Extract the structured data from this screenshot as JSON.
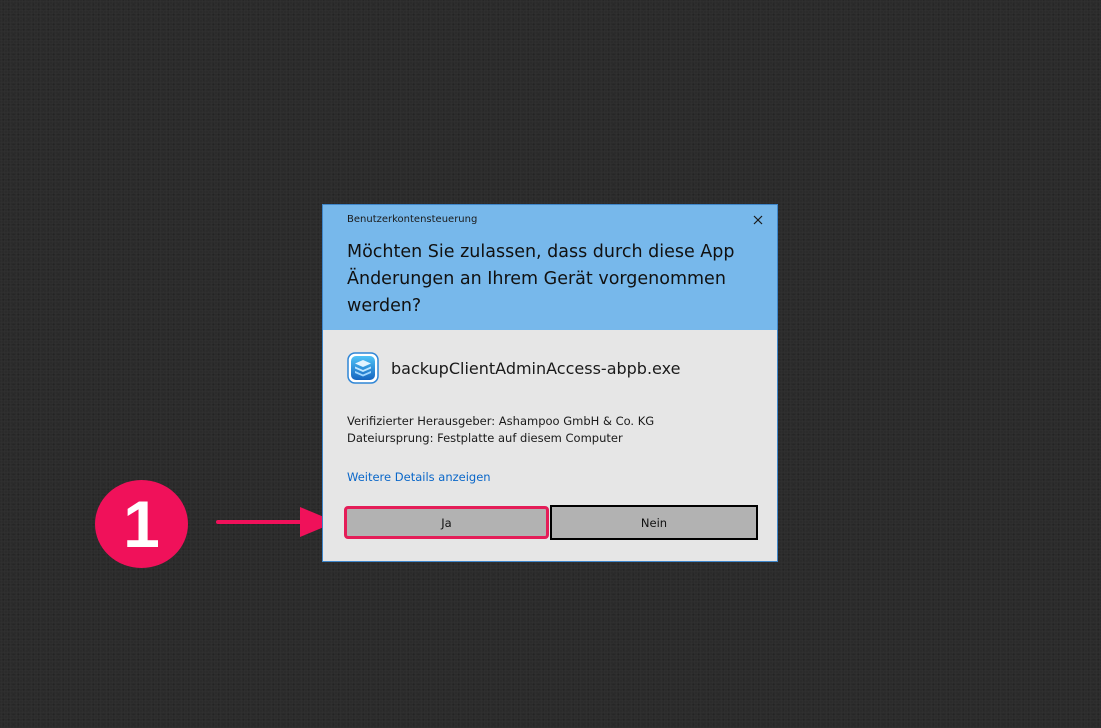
{
  "annotation": {
    "step_number": "1",
    "badge_color": "#f0115a"
  },
  "dialog": {
    "title": "Benutzerkontensteuerung",
    "question": "Möchten Sie zulassen, dass durch diese App Änderungen an Ihrem Gerät vorgenommen werden?",
    "app_icon": "backup-app-icon",
    "app_name": "backupClientAdminAccess-abpb.exe",
    "publisher": "Verifizierter Herausgeber: Ashampoo GmbH & Co. KG",
    "origin": "Dateiursprung: Festplatte auf diesem Computer",
    "details_link": "Weitere Details anzeigen",
    "yes_label": "Ja",
    "no_label": "Nein",
    "header_color": "#77b8eb",
    "body_color": "#e6e6e6",
    "link_color": "#0a67c9"
  }
}
